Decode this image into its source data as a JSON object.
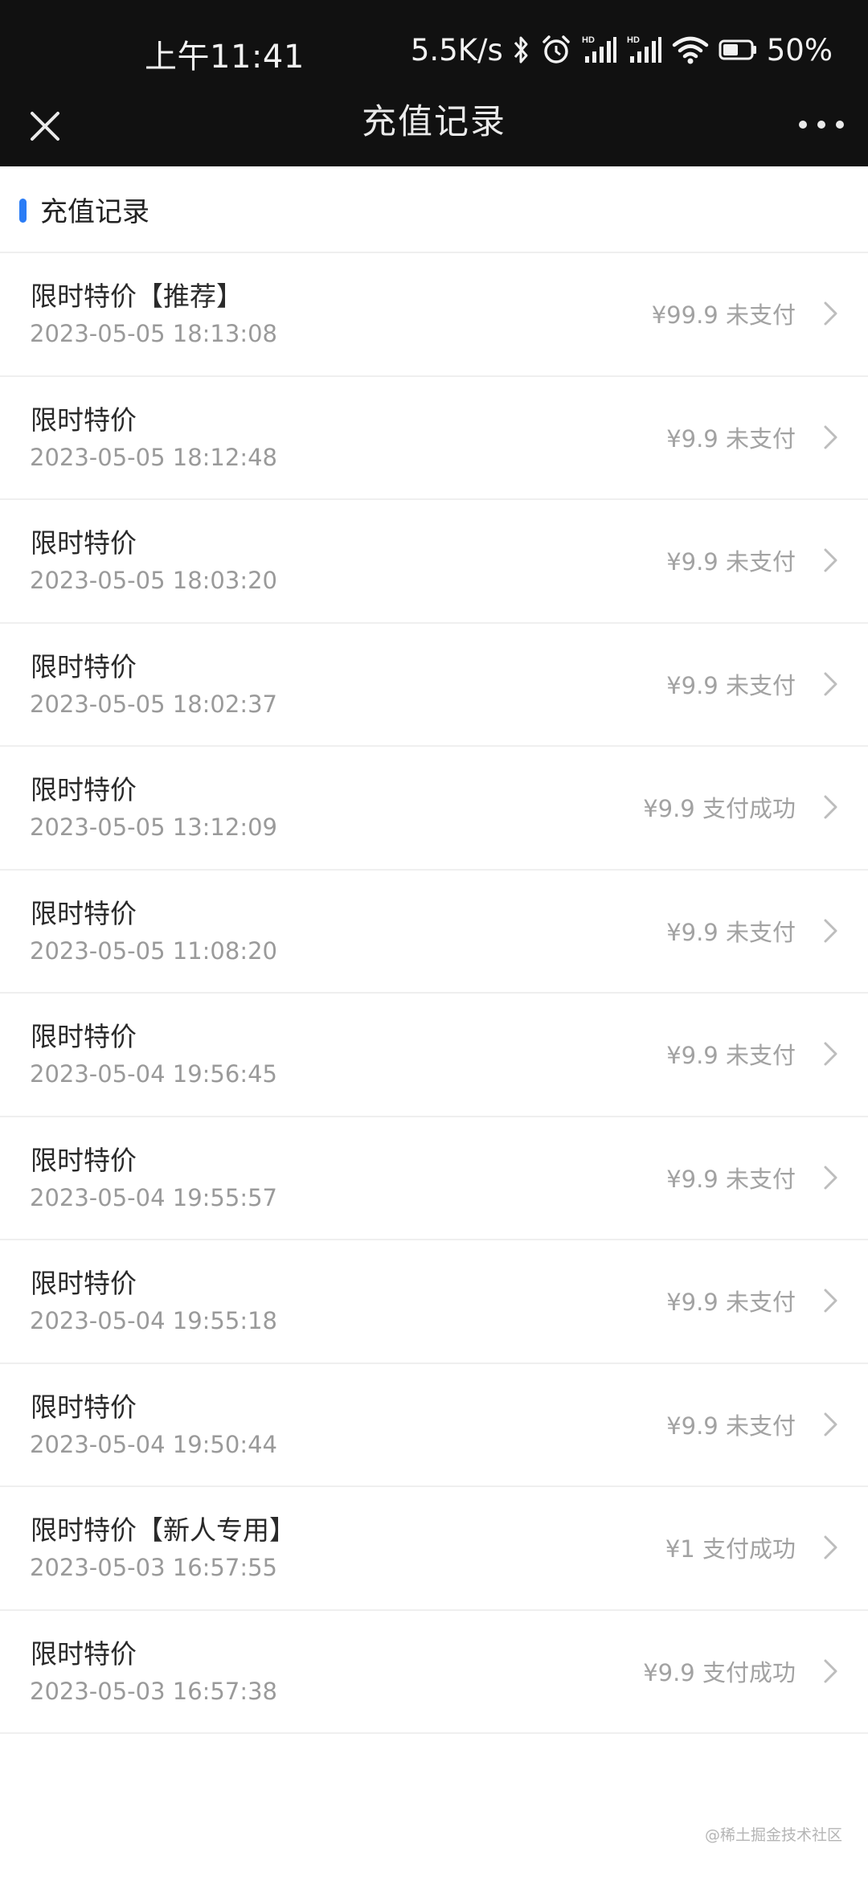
{
  "status_bar": {
    "time": "上午11:41",
    "network_speed": "5.5K/s",
    "battery": "50%",
    "icons": [
      "bluetooth-icon",
      "alarm-icon",
      "hd-signal-icon",
      "hd-signal-icon",
      "wifi-icon",
      "battery-icon"
    ]
  },
  "titlebar": {
    "title": "充值记录",
    "close_icon": "close-icon",
    "more_icon": "more-dots-icon"
  },
  "section": {
    "title": "充值记录",
    "accent_color": "#2a7cf6"
  },
  "records": [
    {
      "name": "限时特价【推荐】",
      "time": "2023-05-05 18:13:08",
      "amount": "¥99.9",
      "status": "未支付"
    },
    {
      "name": "限时特价",
      "time": "2023-05-05 18:12:48",
      "amount": "¥9.9",
      "status": "未支付"
    },
    {
      "name": "限时特价",
      "time": "2023-05-05 18:03:20",
      "amount": "¥9.9",
      "status": "未支付"
    },
    {
      "name": "限时特价",
      "time": "2023-05-05 18:02:37",
      "amount": "¥9.9",
      "status": "未支付"
    },
    {
      "name": "限时特价",
      "time": "2023-05-05 13:12:09",
      "amount": "¥9.9",
      "status": "支付成功"
    },
    {
      "name": "限时特价",
      "time": "2023-05-05 11:08:20",
      "amount": "¥9.9",
      "status": "未支付"
    },
    {
      "name": "限时特价",
      "time": "2023-05-04 19:56:45",
      "amount": "¥9.9",
      "status": "未支付"
    },
    {
      "name": "限时特价",
      "time": "2023-05-04 19:55:57",
      "amount": "¥9.9",
      "status": "未支付"
    },
    {
      "name": "限时特价",
      "time": "2023-05-04 19:55:18",
      "amount": "¥9.9",
      "status": "未支付"
    },
    {
      "name": "限时特价",
      "time": "2023-05-04 19:50:44",
      "amount": "¥9.9",
      "status": "未支付"
    },
    {
      "name": "限时特价【新人专用】",
      "time": "2023-05-03 16:57:55",
      "amount": "¥1",
      "status": "支付成功"
    },
    {
      "name": "限时特价",
      "time": "2023-05-03 16:57:38",
      "amount": "¥9.9",
      "status": "支付成功"
    }
  ],
  "watermark": "@稀土掘金技术社区"
}
